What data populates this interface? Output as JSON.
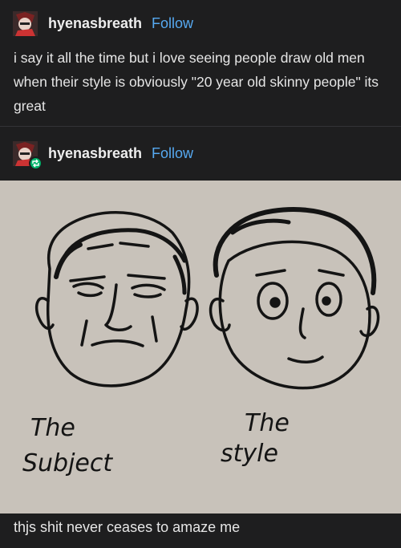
{
  "post": {
    "username": "hyenasbreath",
    "follow_label": "Follow",
    "body": "i say it all the time but i love seeing people draw old men when their style is obviously \"20 year old skinny people\" its great"
  },
  "reblog": {
    "username": "hyenasbreath",
    "follow_label": "Follow",
    "image": {
      "label_left_line1": "The",
      "label_left_line2": "Subject",
      "label_right_line1": "The",
      "label_right_line2": "style"
    },
    "caption": "thjs shit never ceases to amaze me"
  },
  "colors": {
    "background": "#1e1e1f",
    "follow": "#56a9f0",
    "image_bg": "#c8c2ba",
    "reblog_badge": "#00b36b"
  }
}
